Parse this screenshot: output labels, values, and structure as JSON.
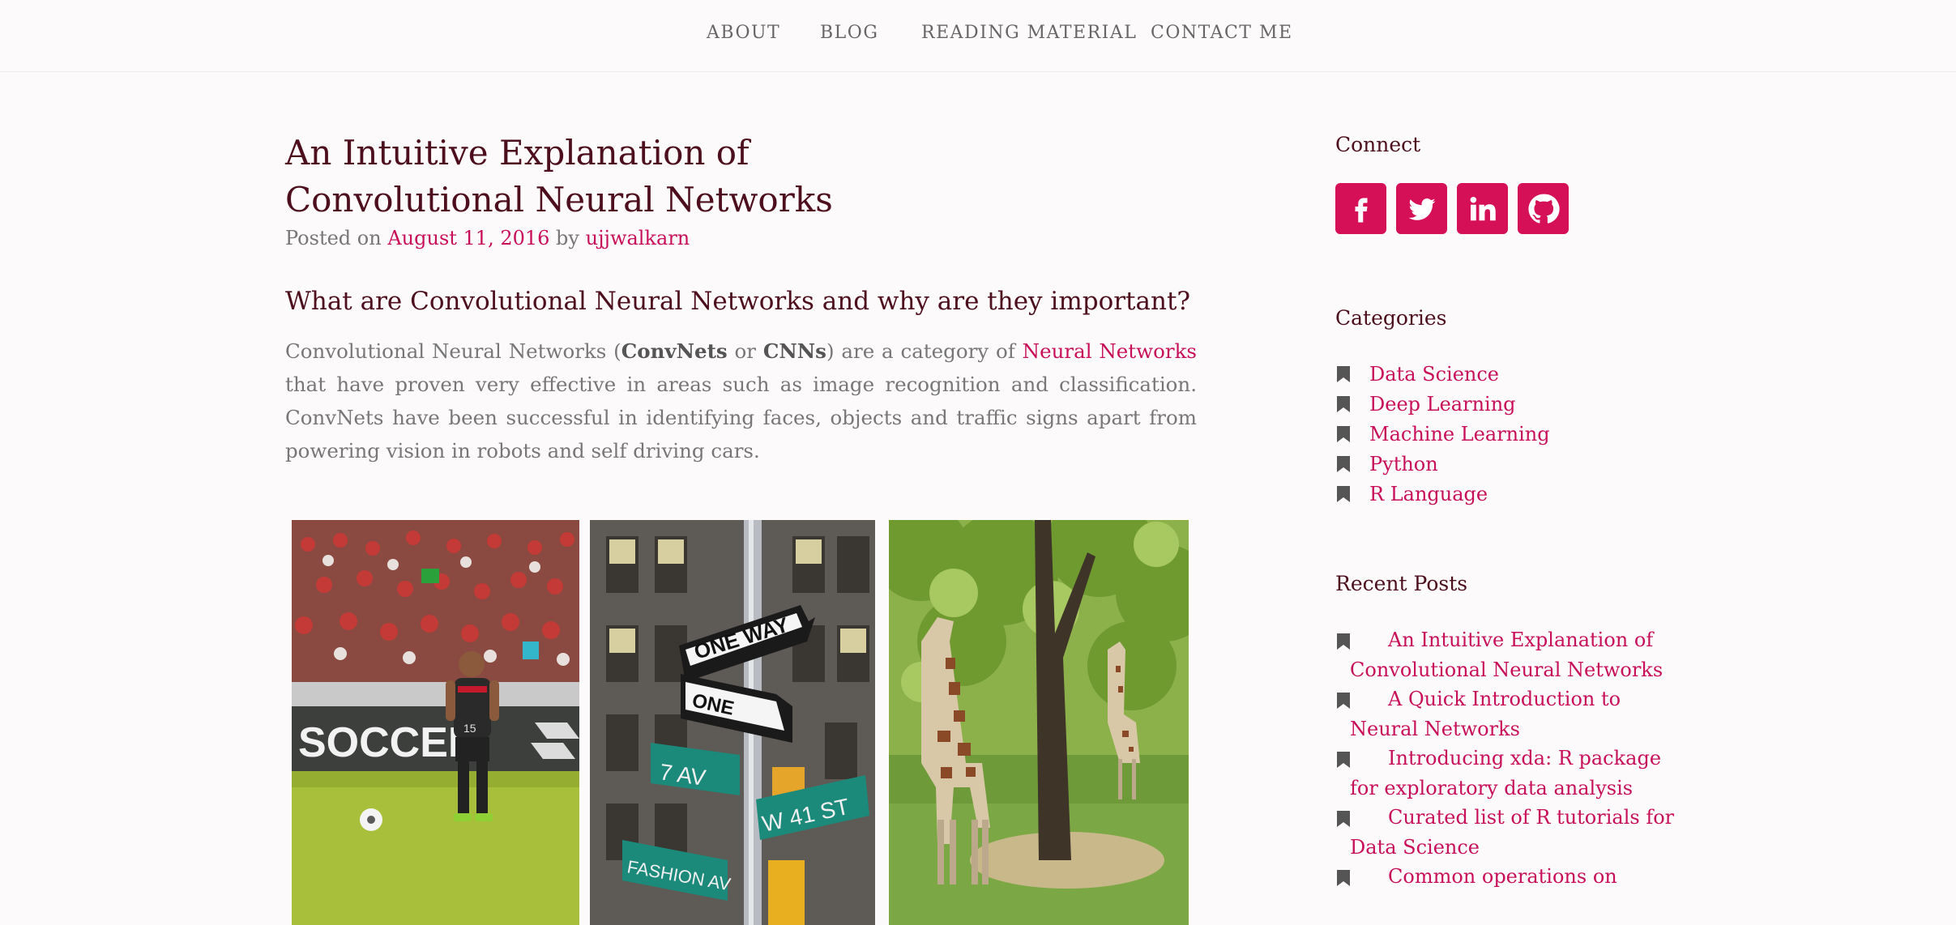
{
  "nav": {
    "items": [
      {
        "label": "ABOUT"
      },
      {
        "label": "BLOG"
      },
      {
        "label": "READING MATERIAL"
      },
      {
        "label": "CONTACT ME"
      }
    ]
  },
  "post": {
    "title": "An Intuitive Explanation of Convolutional Neural Networks",
    "meta_prefix": "Posted on",
    "date": "August 11, 2016",
    "meta_by": "by",
    "author": "ujjwalkarn",
    "section_heading": "What are Convolutional Neural Networks and why are they important?",
    "intro": {
      "part1": "Convolutional Neural Networks (",
      "bold1": "ConvNets",
      "part2": " or ",
      "bold2": "CNNs",
      "part3": ") are a category of ",
      "link": "Neural Networks",
      "part4": " that have proven very effective in areas such as image recognition and classification. ConvNets have been successful in identifying faces, objects and traffic signs apart from powering vision in robots and self driving cars."
    },
    "images": {
      "soccer": {
        "sign_text": "SOCCER",
        "jersey_number": "15"
      },
      "street": {
        "sign1": "ONE WAY",
        "sign2": "ONE",
        "sign3": "7 AV",
        "sign4": "W 41 ST",
        "sign5": "FASHION AV"
      },
      "giraffes": {}
    }
  },
  "sidebar": {
    "connect_title": "Connect",
    "social": [
      {
        "icon": "facebook-icon"
      },
      {
        "icon": "twitter-icon"
      },
      {
        "icon": "linkedin-icon"
      },
      {
        "icon": "github-icon"
      }
    ],
    "categories_title": "Categories",
    "categories": [
      {
        "label": "Data Science"
      },
      {
        "label": "Deep Learning"
      },
      {
        "label": "Machine Learning"
      },
      {
        "label": "Python"
      },
      {
        "label": "R Language"
      }
    ],
    "recent_title": "Recent Posts",
    "recent_posts": [
      {
        "label": "An Intuitive Explanation of Convolutional Neural Networks"
      },
      {
        "label": "A Quick Introduction to Neural Networks"
      },
      {
        "label": "Introducing xda: R package for exploratory data analysis"
      },
      {
        "label": "Curated list of R tutorials for Data Science"
      },
      {
        "label": "Common operations on"
      }
    ]
  },
  "colors": {
    "accent": "#c8105a",
    "title": "#4d0f1e",
    "social_bg": "#d51057",
    "background": "#fcfafa"
  }
}
